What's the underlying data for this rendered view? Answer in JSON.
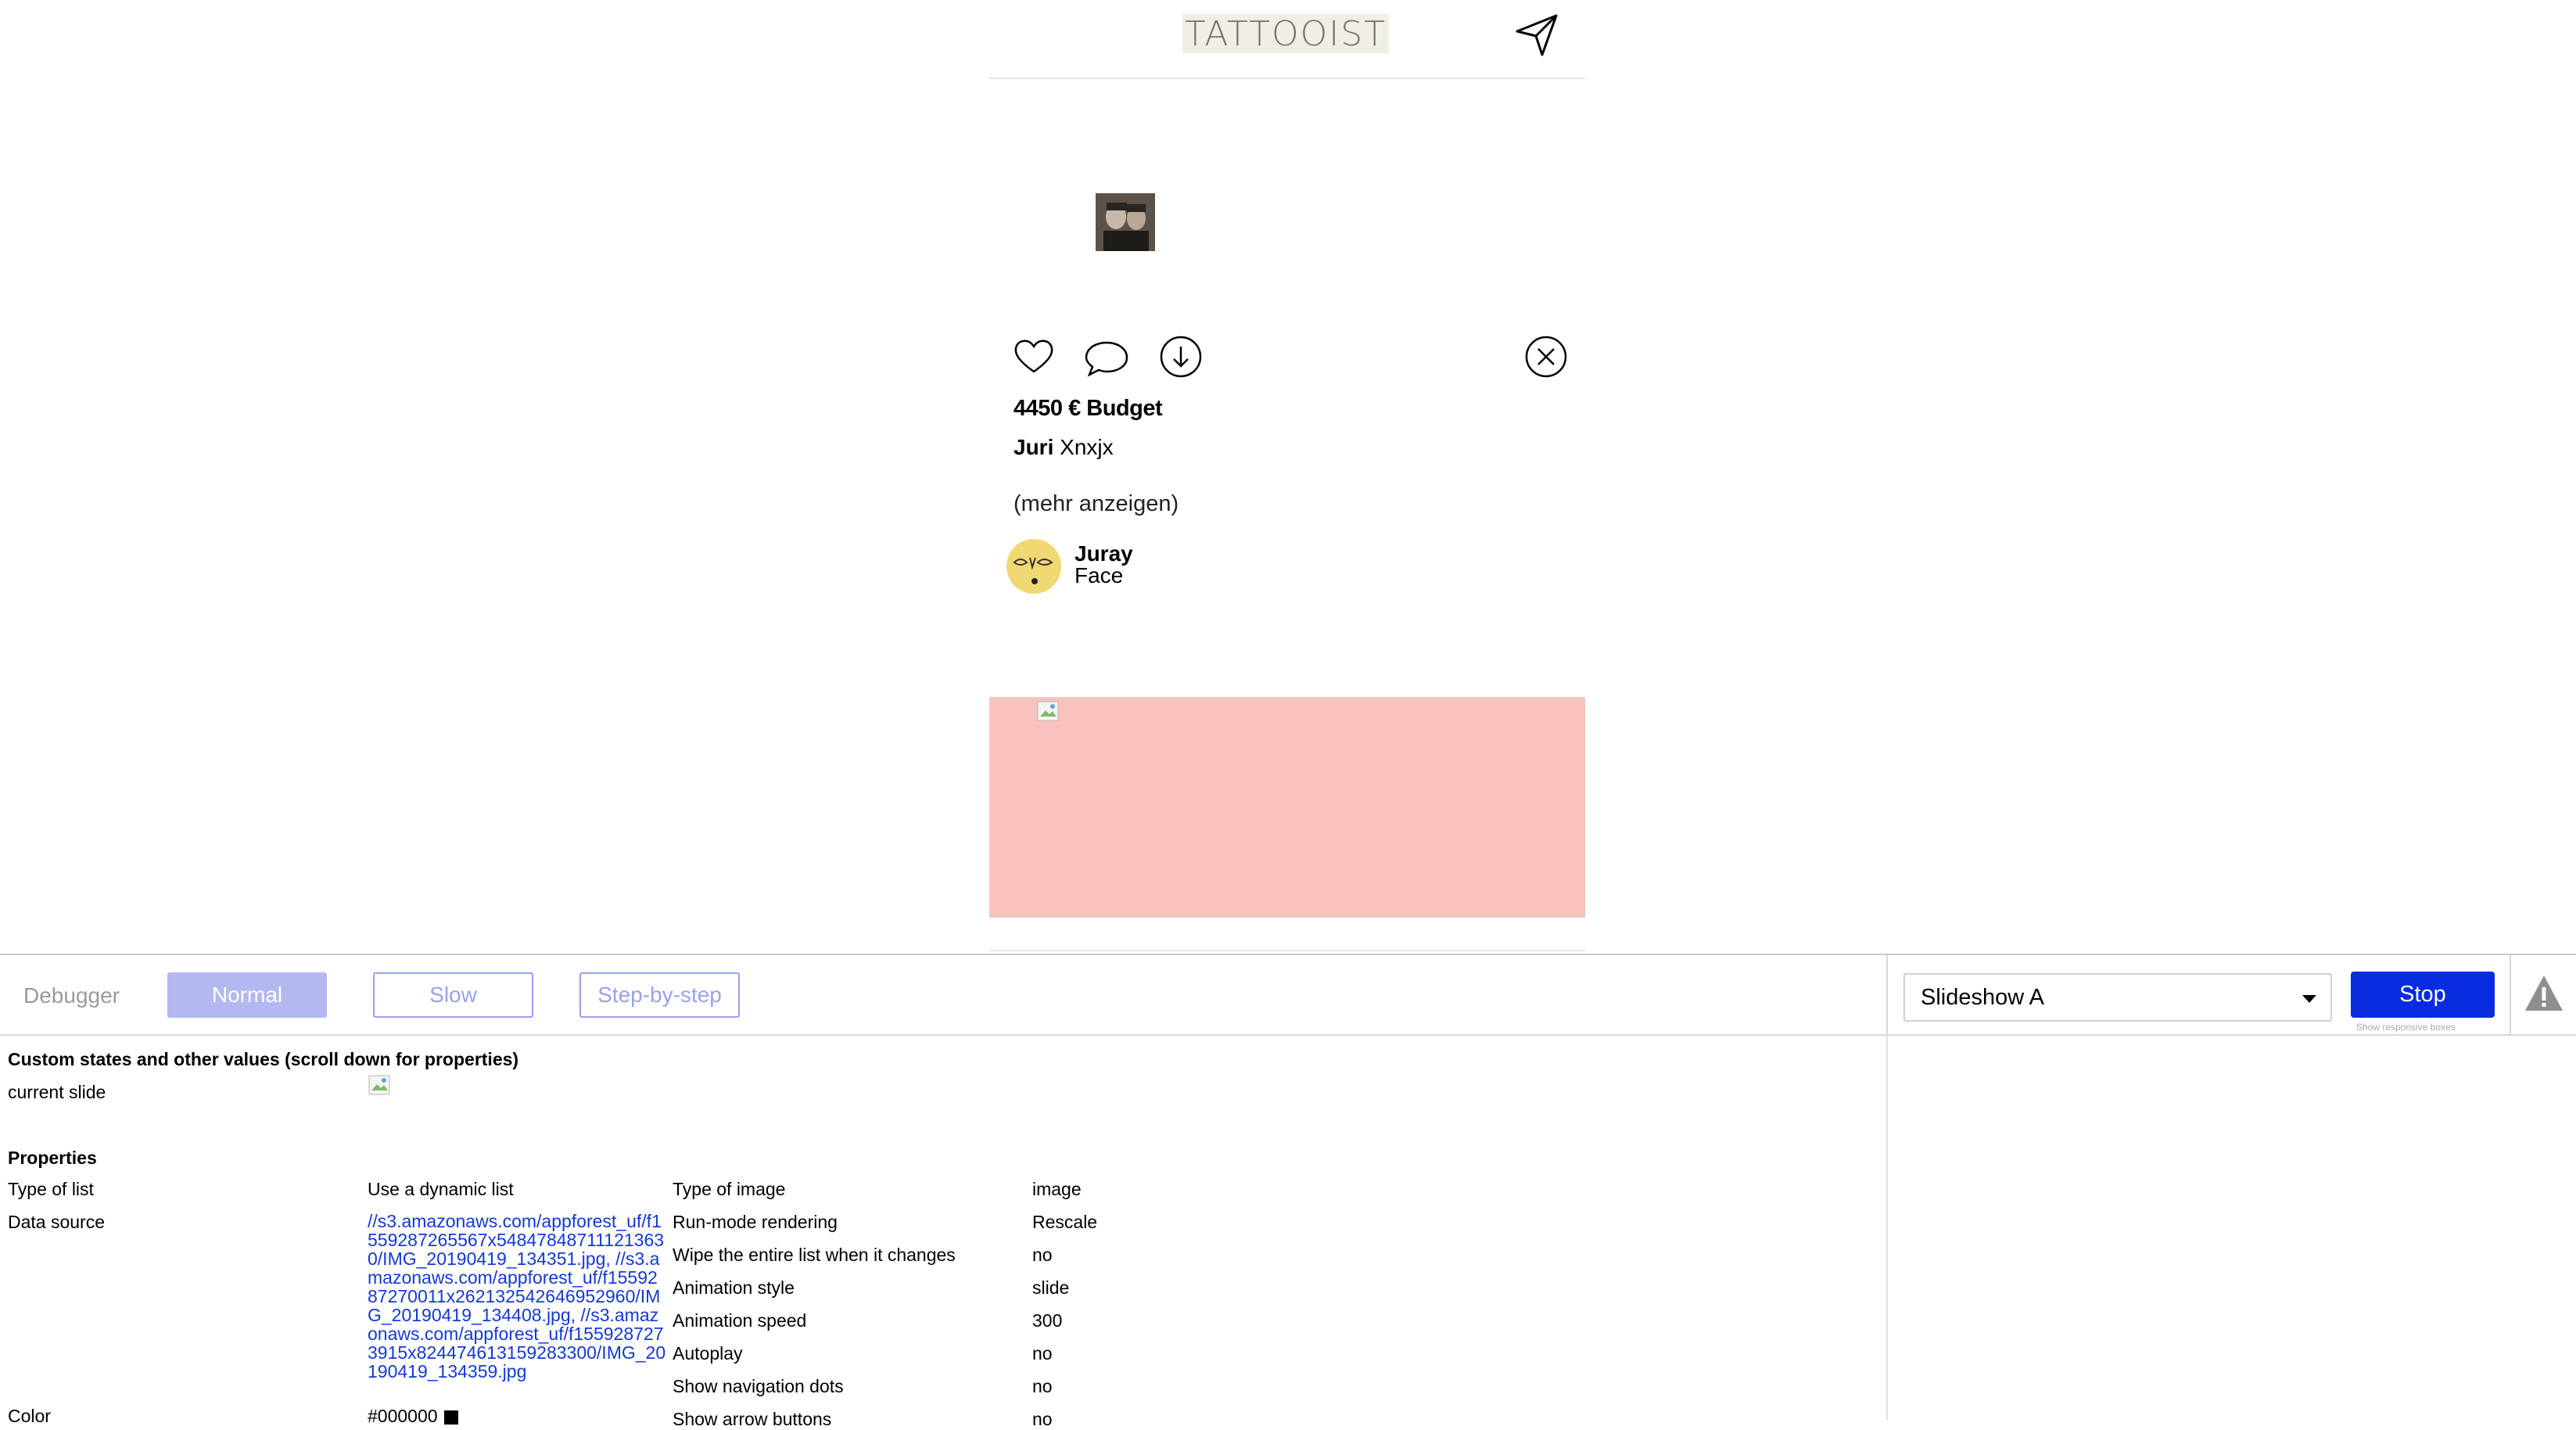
{
  "app": {
    "logo_text": "TATTOOIST",
    "budget": "4450 € Budget",
    "author_bold": "Juri",
    "author_text": "Xnxjx",
    "show_more": "(mehr anzeigen)",
    "commenter_name": "Juray",
    "commenter_sub": "Face",
    "colors": {
      "slide_bg": "#f8c2bf",
      "logo_bg": "#f1eee8",
      "avatar_bg": "#f0d873"
    }
  },
  "debugger": {
    "label": "Debugger",
    "modes": {
      "normal": "Normal",
      "slow": "Slow",
      "step": "Step-by-step"
    },
    "element_selected": "Slideshow A",
    "stop_label": "Stop",
    "responsive_label": "Show responsive boxes",
    "colors": {
      "stop": "#0a2ce0",
      "active_mode": "#b3b8f1",
      "link": "#1438d8"
    },
    "custom_states_title": "Custom states and other values (scroll down for properties)",
    "current_slide_label": "current slide",
    "properties_title": "Properties",
    "props_left": [
      {
        "label": "Type of list",
        "value": "Use a dynamic list"
      },
      {
        "label": "Data source",
        "value": "//s3.amazonaws.com/appforest_uf/f1559287265567x548478487111213630/IMG_20190419_134351.jpg, //s3.amazonaws.com/appforest_uf/f1559287270011x262132542646952960/IMG_20190419_134408.jpg, //s3.amazonaws.com/appforest_uf/f1559287273915x824474613159283300/IMG_20190419_134359.jpg"
      },
      {
        "label": "Color",
        "value": "#000000"
      }
    ],
    "props_right": [
      {
        "label": "Type of image",
        "value": "image"
      },
      {
        "label": "Run-mode rendering",
        "value": "Rescale"
      },
      {
        "label": "Wipe the entire list when it changes",
        "value": "no"
      },
      {
        "label": "Animation style",
        "value": "slide"
      },
      {
        "label": "Animation speed",
        "value": "300"
      },
      {
        "label": "Autoplay",
        "value": "no"
      },
      {
        "label": "Show navigation dots",
        "value": "no"
      },
      {
        "label": "Show arrow buttons",
        "value": "no"
      }
    ]
  }
}
